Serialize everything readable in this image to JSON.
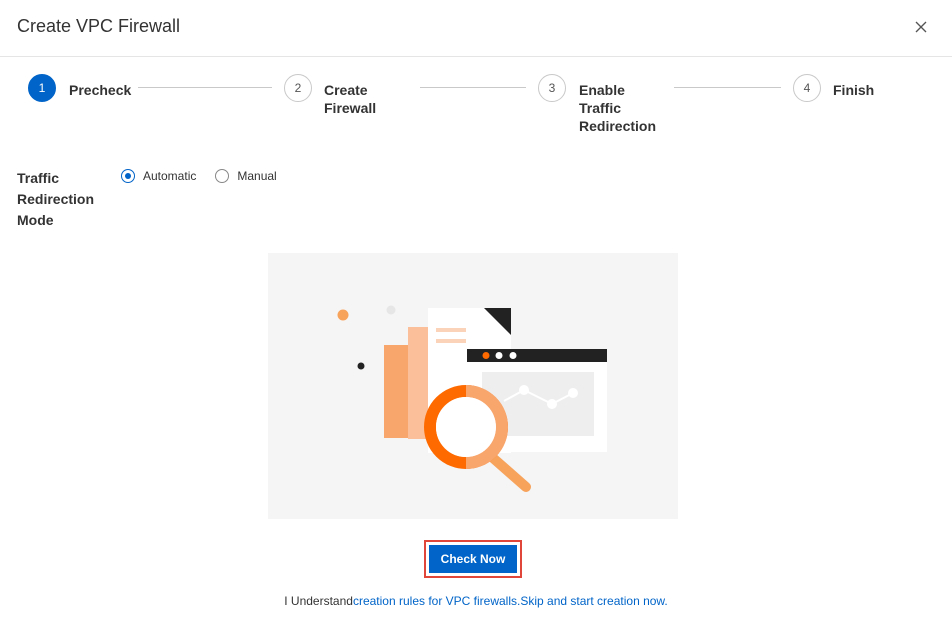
{
  "dialog": {
    "title": "Create VPC Firewall",
    "close_icon": "close-icon"
  },
  "steps": [
    {
      "number": "1",
      "label": "Precheck",
      "active": true
    },
    {
      "number": "2",
      "label": "Create Firewall",
      "active": false
    },
    {
      "number": "3",
      "label": "Enable Traffic Redirection",
      "active": false
    },
    {
      "number": "4",
      "label": "Finish",
      "active": false
    }
  ],
  "mode": {
    "label": "Traffic Redirection Mode",
    "options": [
      {
        "label": "Automatic",
        "selected": true
      },
      {
        "label": "Manual",
        "selected": false
      }
    ]
  },
  "illustration": {
    "icon": "search-magnifier-illustration"
  },
  "check_button": {
    "label": "Check Now"
  },
  "footer": {
    "prefix": "I Understand",
    "rules_link": "creation rules for VPC firewalls.",
    "skip_link": "Skip and start creation now."
  },
  "colors": {
    "primary": "#0064c8",
    "highlight_border": "#e0473a",
    "accent_orange": "#ff6a00"
  }
}
